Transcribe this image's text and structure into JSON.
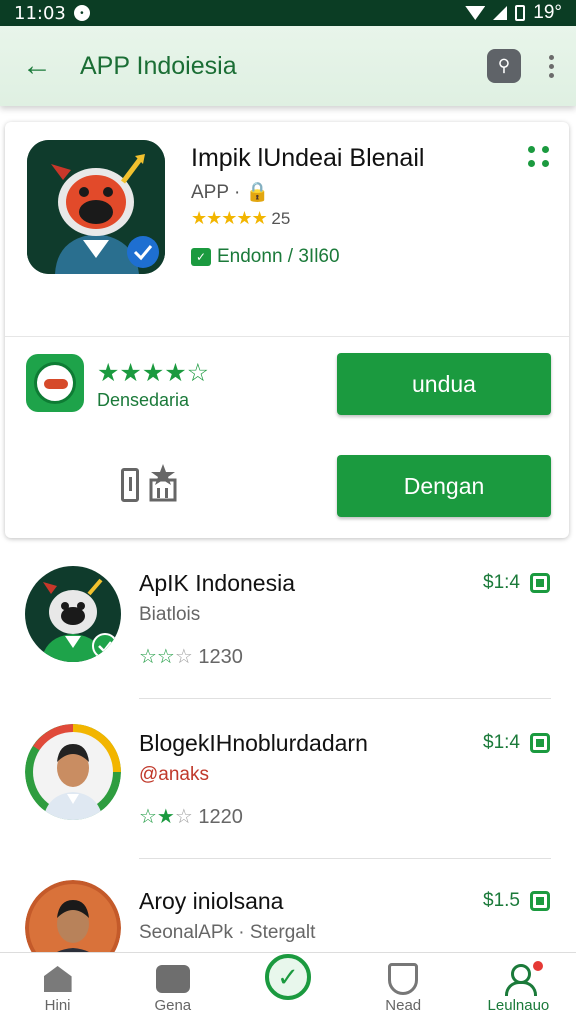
{
  "status_bar": {
    "time": "11:03",
    "right_text": "19°"
  },
  "app_bar": {
    "title": "APP Indoiesia"
  },
  "featured": {
    "name": "Impik lUndeai Blenail",
    "developer": "APP · 🔒",
    "rating_stars": "★★★★★",
    "rating_value": "25",
    "editor_label": "Endonn / 3Il60",
    "small_stars": "★★★★☆",
    "small_label": "Densedaria",
    "install_label": "undua",
    "open_label": "Dengan"
  },
  "list": [
    {
      "title": "ApIK Indonesia",
      "subtitle": "Biatlois",
      "stars_green": "☆☆",
      "stars_grey": "☆",
      "count": "1230",
      "price": "$1:4"
    },
    {
      "title": "BlogekIHnoblurdadarn",
      "subtitle": "@anaks",
      "stars_green": "☆★",
      "stars_grey": "☆",
      "count": "1220",
      "price": "$1:4"
    },
    {
      "title": "Aroy iniolsana",
      "subtitle": "SeonalAPk · Stergalt",
      "price": "$1.5"
    }
  ],
  "bottom_nav": [
    {
      "label": "Hini"
    },
    {
      "label": "Gena"
    },
    {
      "label": ""
    },
    {
      "label": "Nead"
    },
    {
      "label": "Leulnauo"
    }
  ],
  "colors": {
    "accent": "#1b9a3f",
    "status_bar": "#0b3d24",
    "app_bar": "#e8f5ea"
  }
}
